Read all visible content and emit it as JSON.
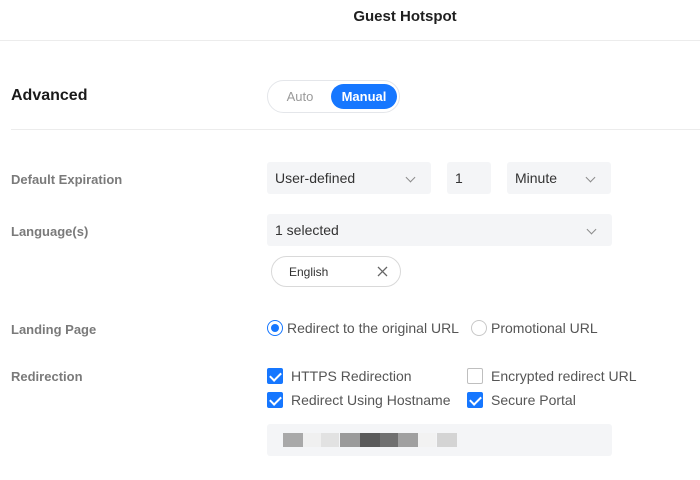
{
  "header": {
    "title": "Guest Hotspot"
  },
  "advanced": {
    "title": "Advanced",
    "mode_options": [
      "Auto",
      "Manual"
    ],
    "selected_mode": "Manual"
  },
  "form": {
    "default_expiration": {
      "label": "Default Expiration",
      "type_value": "User-defined",
      "amount_value": "1",
      "unit_value": "Minute"
    },
    "languages": {
      "label": "Language(s)",
      "select_value": "1 selected",
      "tags": [
        "English"
      ]
    },
    "landing_page": {
      "label": "Landing Page",
      "options": [
        {
          "label": "Redirect to the original URL",
          "checked": true
        },
        {
          "label": "Promotional URL",
          "checked": false
        }
      ]
    },
    "redirection": {
      "label": "Redirection",
      "checkboxes": [
        {
          "label": "HTTPS Redirection",
          "checked": true
        },
        {
          "label": "Encrypted redirect URL",
          "checked": false
        },
        {
          "label": "Redirect Using Hostname",
          "checked": true
        },
        {
          "label": "Secure Portal",
          "checked": true
        }
      ]
    }
  },
  "colors": {
    "accent": "#1677ff",
    "field_background": "#f4f5f7",
    "label_gray": "#7a7a7a"
  },
  "icons": [
    "chevron-down-icon",
    "close-icon"
  ]
}
